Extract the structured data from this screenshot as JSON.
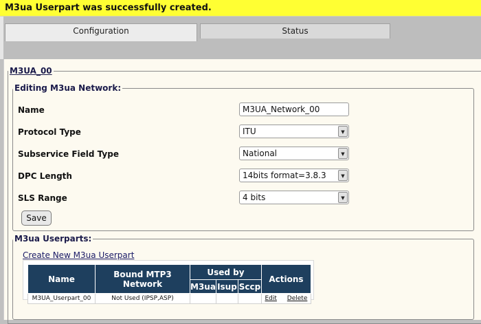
{
  "banner": {
    "message": "M3ua Userpart was successfully created."
  },
  "tabs": [
    {
      "label": "Configuration",
      "active": true
    },
    {
      "label": "Status",
      "active": false
    }
  ],
  "outer_legend": "M3UA_00",
  "edit": {
    "legend": "Editing M3ua Network:",
    "fields": {
      "name": {
        "label": "Name",
        "value": "M3UA_Network_00"
      },
      "protocol_type": {
        "label": "Protocol Type",
        "value": "ITU"
      },
      "subservice": {
        "label": "Subservice Field Type",
        "value": "National"
      },
      "dpc_length": {
        "label": "DPC Length",
        "value": "14bits format=3.8.3"
      },
      "sls_range": {
        "label": "SLS Range",
        "value": "4 bits"
      }
    },
    "save_label": "Save"
  },
  "userparts": {
    "legend": "M3ua Userparts:",
    "create_link": "Create New M3ua Userpart",
    "headers": {
      "name": "Name",
      "bound": "Bound MTP3 Network",
      "used_by": "Used by",
      "m3ua": "M3ua",
      "isup": "Isup",
      "sccp": "Sccp",
      "actions": "Actions"
    },
    "rows": [
      {
        "name": "M3UA_Userpart_00",
        "bound": "Not Used (IPSP,ASP)",
        "m3ua": "",
        "isup": "",
        "sccp": "",
        "edit": "Edit",
        "delete": "Delete"
      }
    ]
  },
  "colors": {
    "banner": "#ffff33",
    "table_header": "#1e3f5e",
    "page_bg": "#fdfaf0"
  }
}
